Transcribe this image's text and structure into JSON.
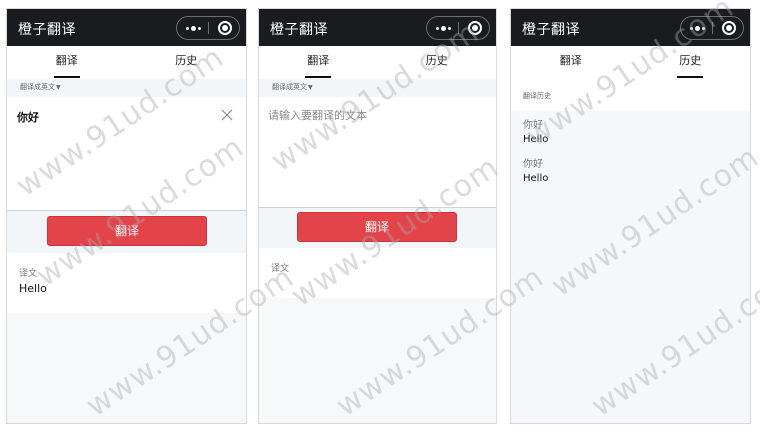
{
  "app": {
    "title": "橙子翻译"
  },
  "tabs": {
    "translate": "翻译",
    "history": "历史"
  },
  "screen1": {
    "lang_selector": "翻译成英文",
    "input_value": "你好",
    "translate_button": "翻译",
    "result_label": "译文",
    "result_value": "Hello"
  },
  "screen2": {
    "lang_selector": "翻译成英文",
    "input_placeholder": "请输入要翻译的文本",
    "translate_button": "翻译",
    "result_label": "译文"
  },
  "screen3": {
    "history_label": "翻译历史",
    "entries": [
      {
        "source": "你好",
        "target": "Hello"
      },
      {
        "source": "你好",
        "target": "Hello"
      }
    ]
  },
  "watermark": "www.91ud.com",
  "icons": {
    "menu": "more-dots-icon",
    "close": "target-circle-icon",
    "clear": "clear-x-icon",
    "dropdown": "caret-down-icon"
  },
  "colors": {
    "titlebar": "#1a1b1f",
    "primary_button": "#e2444a",
    "background": "#f6f8fa"
  }
}
